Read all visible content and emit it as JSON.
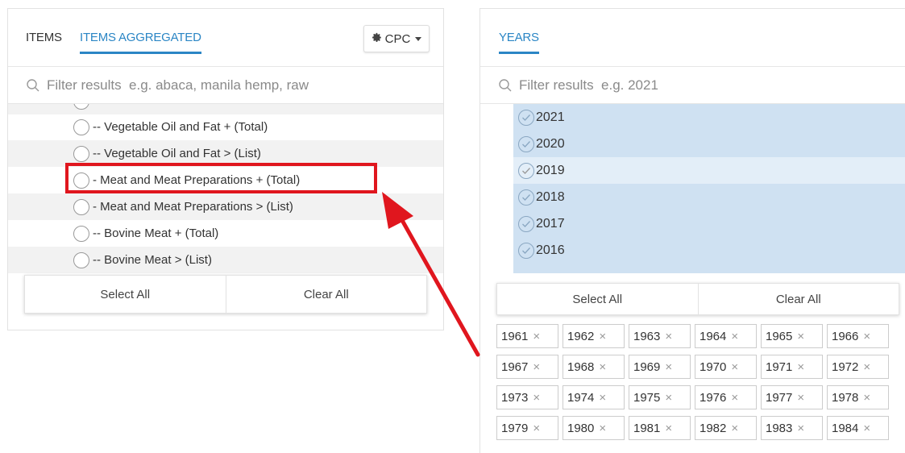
{
  "left_panel": {
    "tabs": [
      {
        "label": "ITEMS",
        "active": false
      },
      {
        "label": "ITEMS AGGREGATED",
        "active": true
      }
    ],
    "cpc_button": {
      "label": "CPC",
      "icon": "gear-icon"
    },
    "search": {
      "placeholder": "Filter results  e.g. abaca, manila hemp, raw"
    },
    "items": [
      {
        "label": "-- Vegetable Oil and Fat + (Total)"
      },
      {
        "label": "-- Vegetable Oil and Fat > (List)"
      },
      {
        "label": "- Meat and Meat Preparations + (Total)",
        "highlighted": true
      },
      {
        "label": "- Meat and Meat Preparations > (List)"
      },
      {
        "label": "-- Bovine Meat + (Total)"
      },
      {
        "label": "-- Bovine Meat > (List)"
      }
    ],
    "select_all": "Select All",
    "clear_all": "Clear All"
  },
  "right_panel": {
    "tabs": [
      {
        "label": "YEARS",
        "active": true
      }
    ],
    "search": {
      "placeholder": "Filter results  e.g. 2021"
    },
    "years": [
      "2021",
      "2020",
      "2019",
      "2018",
      "2017",
      "2016"
    ],
    "select_all": "Select All",
    "clear_all": "Clear All",
    "selected_tags": [
      "1961",
      "1962",
      "1963",
      "1964",
      "1965",
      "1966",
      "1967",
      "1968",
      "1969",
      "1970",
      "1971",
      "1972",
      "1973",
      "1974",
      "1975",
      "1976",
      "1977",
      "1978",
      "1979",
      "1980",
      "1981",
      "1982",
      "1983",
      "1984"
    ]
  },
  "colors": {
    "accent": "#2b86c5",
    "highlight": "#e0161e",
    "selected_row": "#cfe1f2"
  }
}
